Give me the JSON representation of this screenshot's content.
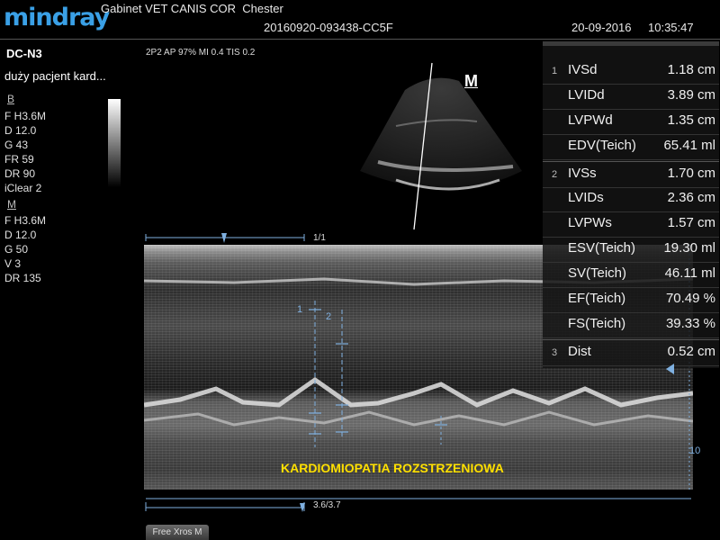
{
  "header": {
    "logo": "mindray",
    "clinic": "Gabinet VET CANIS COR",
    "patient": "Chester",
    "exam_id": "20160920-093438-CC5F",
    "date": "20-09-2016",
    "time": "10:35:47"
  },
  "left": {
    "probe": "DC-N3",
    "patient_type": "duży pacjent kard...",
    "b_mode_label": "B",
    "b_params": [
      "F H3.6M",
      "D 12.0",
      "G 43",
      "FR 59",
      "DR 90",
      "iClear 2"
    ],
    "m_mode_label": "M",
    "m_params": [
      "F H3.6M",
      "D 12.0",
      "G 50",
      "V 3",
      "DR 135"
    ]
  },
  "image_info": {
    "top_params": "2P2  AP 97%  MI 0.4  TIS 0.2",
    "mode_icon": "M",
    "b_scale": "1/1",
    "m_scale": "3.6/3.7",
    "depth_label": "10",
    "annotation": "KARDIOMIOPATIA ROZSTRZENIOWA",
    "marker_1": "1",
    "marker_2": "2"
  },
  "measurements": [
    {
      "idx": "1",
      "name": "IVSd",
      "value": "1.18 cm"
    },
    {
      "idx": "",
      "name": "LVIDd",
      "value": "3.89 cm"
    },
    {
      "idx": "",
      "name": "LVPWd",
      "value": "1.35 cm"
    },
    {
      "idx": "",
      "name": "EDV(Teich)",
      "value": "65.41 ml"
    },
    {
      "idx": "2",
      "name": "IVSs",
      "value": "1.70 cm"
    },
    {
      "idx": "",
      "name": "LVIDs",
      "value": "2.36 cm"
    },
    {
      "idx": "",
      "name": "LVPWs",
      "value": "1.57 cm"
    },
    {
      "idx": "",
      "name": "ESV(Teich)",
      "value": "19.30 ml"
    },
    {
      "idx": "",
      "name": "SV(Teich)",
      "value": "46.11 ml"
    },
    {
      "idx": "",
      "name": "EF(Teich)",
      "value": "70.49 %"
    },
    {
      "idx": "",
      "name": "FS(Teich)",
      "value": "39.33 %"
    },
    {
      "idx": "3",
      "name": "Dist",
      "value": "0.52 cm"
    }
  ],
  "buttons": {
    "free_xros": "Free Xros M"
  },
  "colors": {
    "logo": "#3aa0e6",
    "annotation": "#ffe000",
    "caliper": "#7fb0e0"
  }
}
